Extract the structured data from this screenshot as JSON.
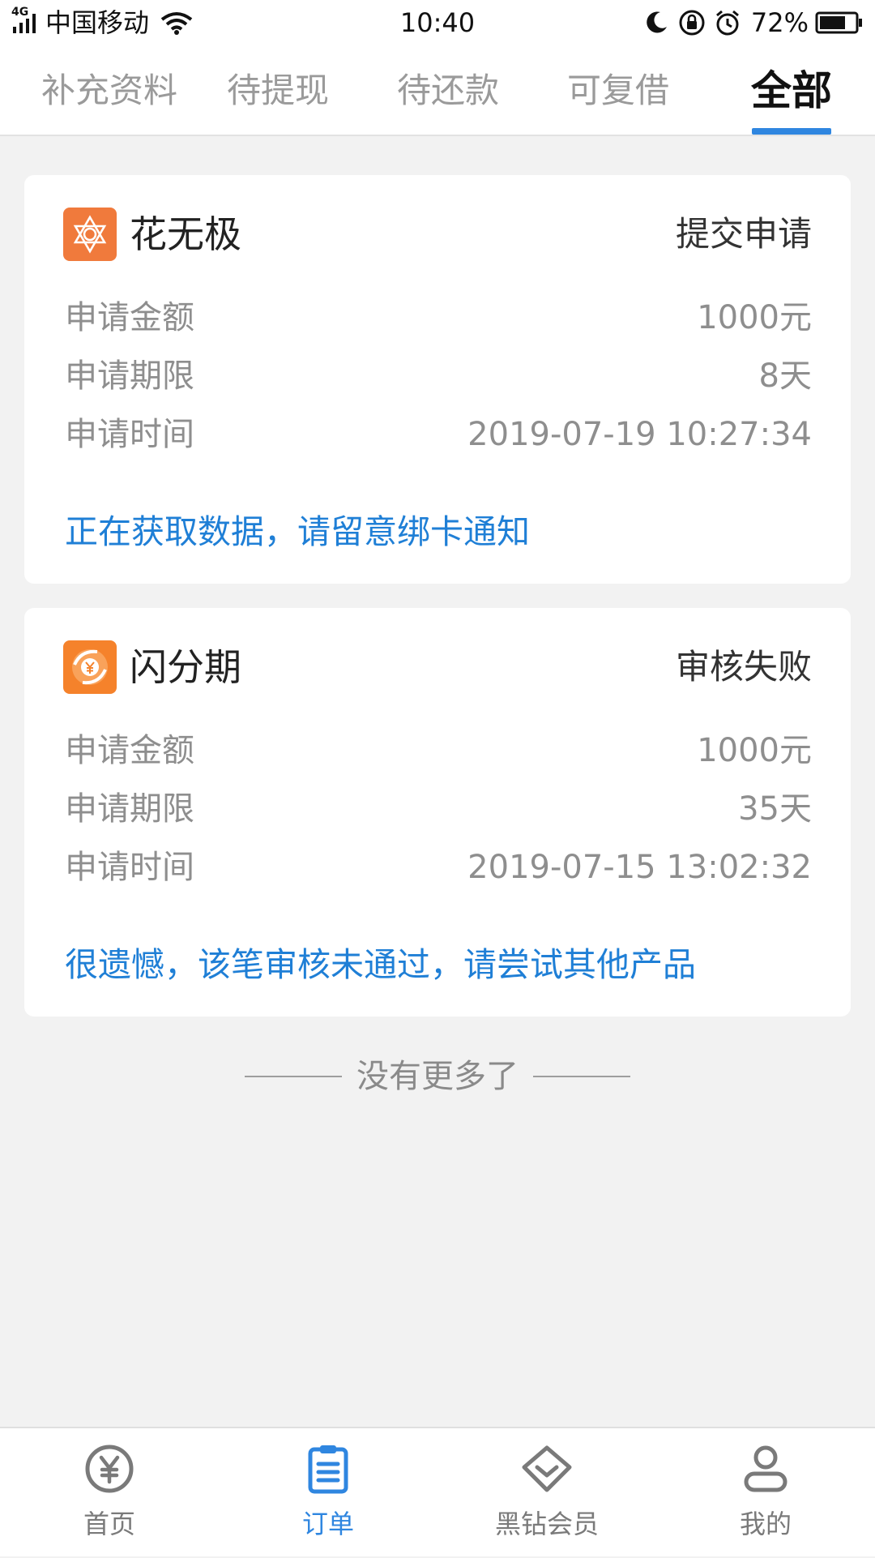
{
  "status_bar": {
    "network": "4G",
    "carrier": "中国移动",
    "time": "10:40",
    "battery_percent": "72%",
    "icons": [
      "signal-icon",
      "wifi-icon",
      "moon-icon",
      "rotation-lock-icon",
      "alarm-icon",
      "battery-icon"
    ]
  },
  "tabs": [
    {
      "label": "补充资料",
      "active": false
    },
    {
      "label": "待提现",
      "active": false
    },
    {
      "label": "待还款",
      "active": false
    },
    {
      "label": "可复借",
      "active": false
    },
    {
      "label": "全部",
      "active": true
    }
  ],
  "orders": [
    {
      "product_name": "花无极",
      "logo_icon": "flower-star-icon",
      "logo_color": "#f07a3c",
      "status": "提交申请",
      "rows": [
        {
          "label": "申请金额",
          "value": "1000元"
        },
        {
          "label": "申请期限",
          "value": "8天"
        },
        {
          "label": "申请时间",
          "value": "2019-07-19 10:27:34"
        }
      ],
      "note": "正在获取数据，请留意绑卡通知"
    },
    {
      "product_name": "闪分期",
      "logo_icon": "yuan-swirl-icon",
      "logo_color": "#f5822b",
      "status": "审核失败",
      "rows": [
        {
          "label": "申请金额",
          "value": "1000元"
        },
        {
          "label": "申请期限",
          "value": "35天"
        },
        {
          "label": "申请时间",
          "value": "2019-07-15 13:02:32"
        }
      ],
      "note": "很遗憾，该笔审核未通过，请尝试其他产品"
    }
  ],
  "list_end_text": "没有更多了",
  "bottom_nav": [
    {
      "label": "首页",
      "icon": "yuan-circle-icon",
      "active": false
    },
    {
      "label": "订单",
      "icon": "clipboard-list-icon",
      "active": true
    },
    {
      "label": "黑钻会员",
      "icon": "diamond-icon",
      "active": false
    },
    {
      "label": "我的",
      "icon": "user-icon",
      "active": false
    }
  ],
  "colors": {
    "accent": "#2f86e0",
    "note_blue": "#1f7fd6",
    "background": "#f2f2f2",
    "muted_text": "#8e8e8e",
    "inactive_nav": "#8a8a8a"
  }
}
